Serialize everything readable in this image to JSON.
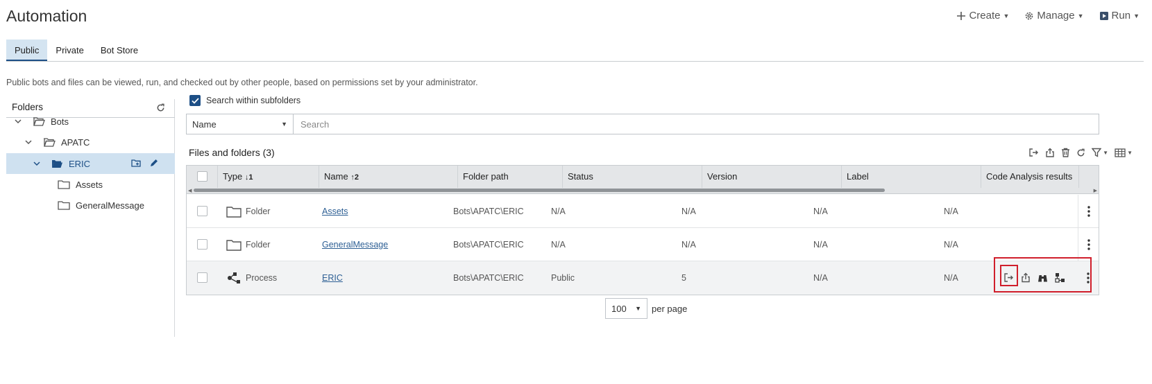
{
  "header": {
    "title": "Automation",
    "actions": [
      {
        "label": "Create",
        "icon": "plus-icon"
      },
      {
        "label": "Manage",
        "icon": "gear-icon"
      },
      {
        "label": "Run",
        "icon": "play-icon"
      }
    ]
  },
  "tabs": [
    {
      "label": "Public",
      "active": true
    },
    {
      "label": "Private",
      "active": false
    },
    {
      "label": "Bot Store",
      "active": false
    }
  ],
  "info_text": "Public bots and files can be viewed, run, and checked out by other people, based on permissions set by your administrator.",
  "folders": {
    "title": "Folders",
    "tree": [
      {
        "label": "Bots",
        "expanded": true,
        "level": 0
      },
      {
        "label": "APATC",
        "expanded": true,
        "level": 1
      },
      {
        "label": "ERIC",
        "expanded": true,
        "level": 2,
        "selected": true
      },
      {
        "label": "Assets",
        "level": 3
      },
      {
        "label": "GeneralMessage",
        "level": 3
      }
    ]
  },
  "search": {
    "subfolders_label": "Search within subfolders",
    "subfolders_checked": true,
    "field": "Name",
    "placeholder": "Search"
  },
  "table": {
    "title": "Files and folders (3)",
    "columns": {
      "type": "Type",
      "type_sort": "↓1",
      "name": "Name",
      "name_sort": "↑2",
      "folder_path": "Folder path",
      "status": "Status",
      "version": "Version",
      "label": "Label",
      "code_analysis": "Code Analysis results"
    },
    "rows": [
      {
        "type": "Folder",
        "name": "Assets",
        "folder_path": "Bots\\APATC\\ERIC",
        "status": "N/A",
        "version": "N/A",
        "label": "N/A",
        "code_analysis": "N/A"
      },
      {
        "type": "Folder",
        "name": "GeneralMessage",
        "folder_path": "Bots\\APATC\\ERIC",
        "status": "N/A",
        "version": "N/A",
        "label": "N/A",
        "code_analysis": "N/A"
      },
      {
        "type": "Process",
        "name": "ERIC",
        "folder_path": "Bots\\APATC\\ERIC",
        "status": "Public",
        "version": "5",
        "label": "N/A",
        "code_analysis": "N/A"
      }
    ]
  },
  "pager": {
    "page_size": "100",
    "label": "per page"
  },
  "colors": {
    "accent": "#1d4f86",
    "tab_active_bg": "#d4e4f1",
    "highlight": "#d01e2b"
  }
}
